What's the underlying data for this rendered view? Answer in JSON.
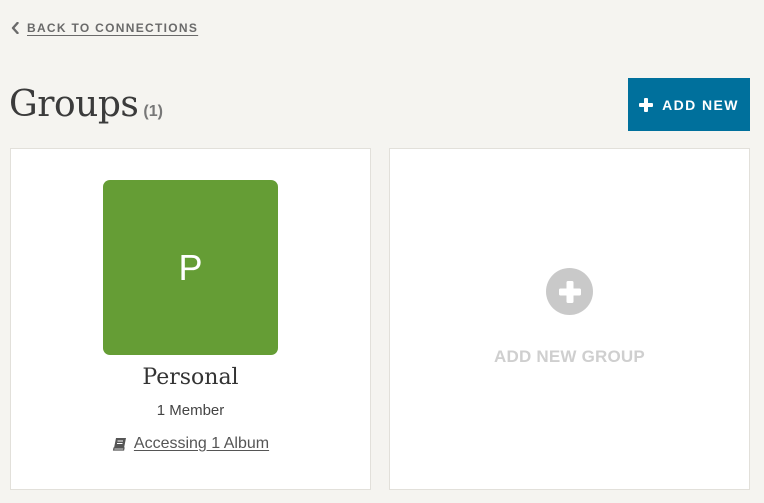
{
  "nav": {
    "back_label": "BACK TO CONNECTIONS",
    "back_icon": "chevron-left-icon"
  },
  "header": {
    "title": "Groups",
    "count": "(1)",
    "add_new_label": "ADD NEW",
    "add_new_icon": "plus-icon",
    "add_new_color": "#00709c"
  },
  "groups": [
    {
      "initial": "P",
      "name": "Personal",
      "members": "1 Member",
      "albums": "Accessing 1 Album",
      "albums_icon": "book-icon",
      "color": "#659d35"
    }
  ],
  "add_group_card": {
    "label": "ADD NEW GROUP",
    "icon": "plus-circle-icon"
  }
}
